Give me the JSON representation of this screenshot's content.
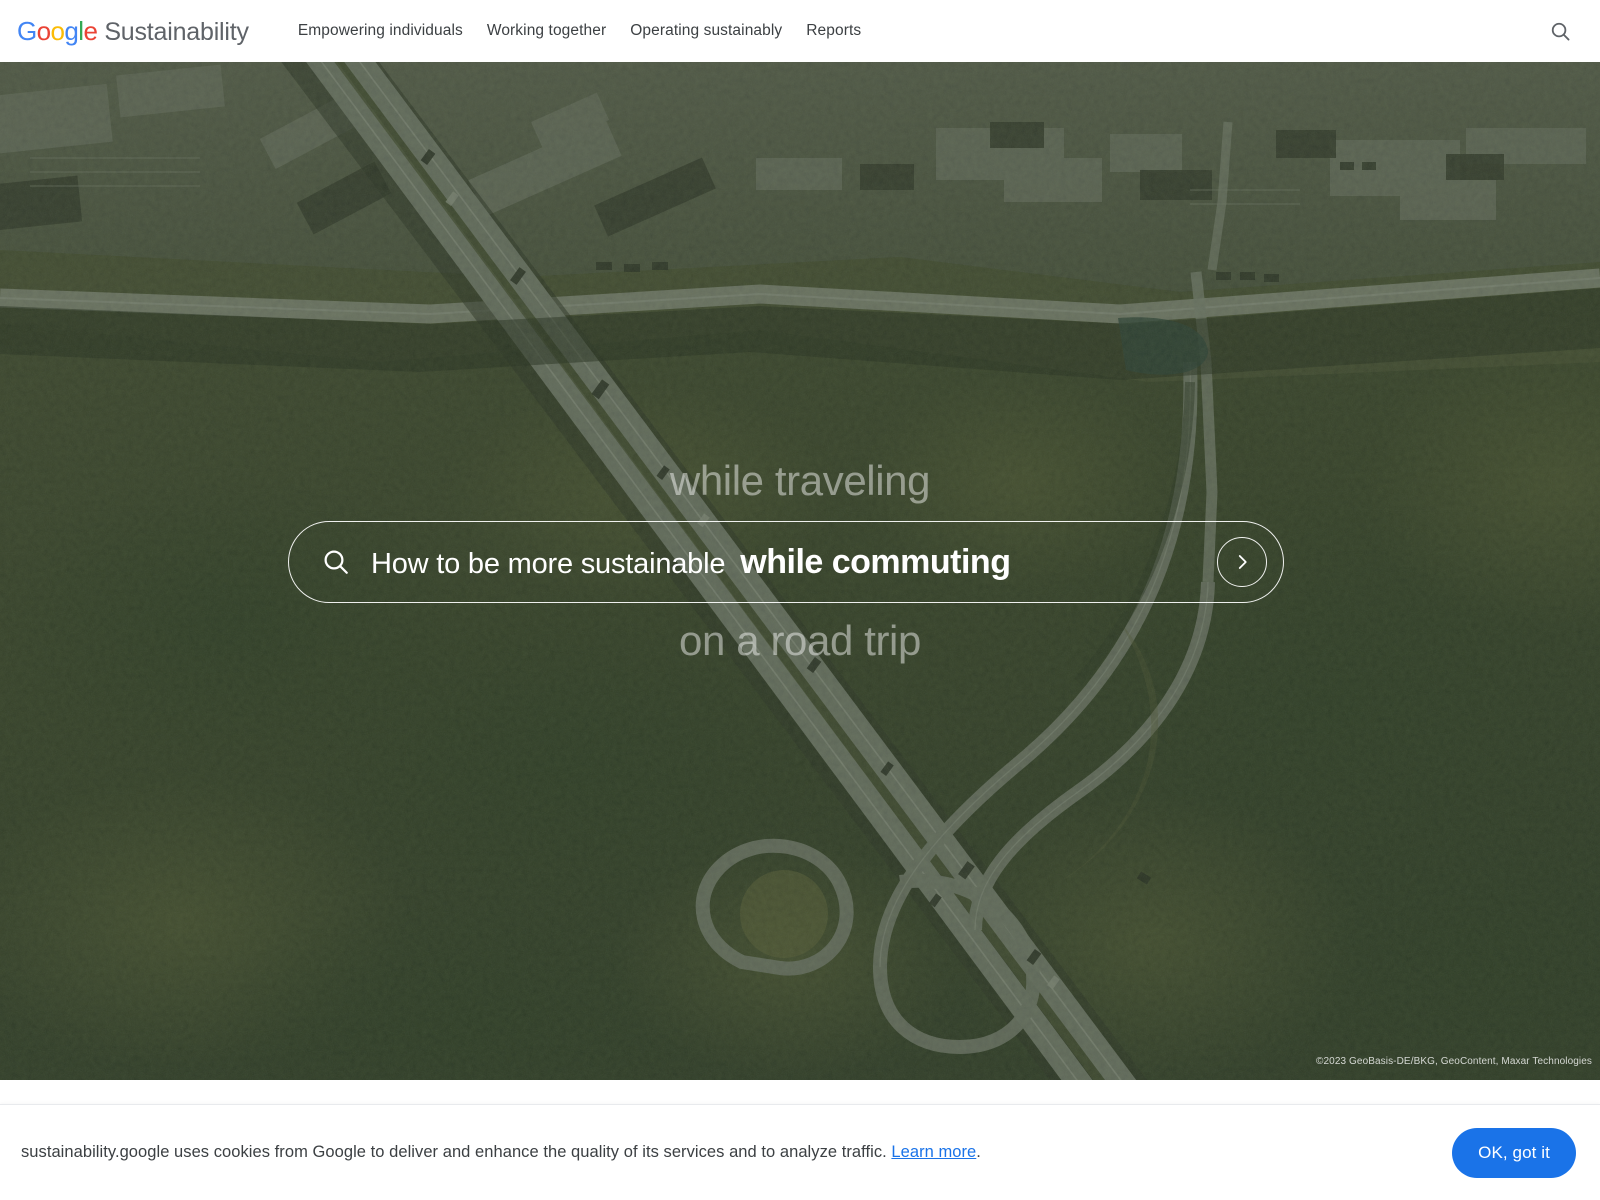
{
  "header": {
    "logo": {
      "google_letters": [
        {
          "ch": "G",
          "color": "#4285f4"
        },
        {
          "ch": "o",
          "color": "#ea4335"
        },
        {
          "ch": "o",
          "color": "#fbbc05"
        },
        {
          "ch": "g",
          "color": "#4285f4"
        },
        {
          "ch": "l",
          "color": "#34a853"
        },
        {
          "ch": "e",
          "color": "#ea4335"
        }
      ],
      "product": "Sustainability"
    },
    "nav": [
      {
        "label": "Empowering individuals"
      },
      {
        "label": "Working together"
      },
      {
        "label": "Operating sustainably"
      },
      {
        "label": "Reports"
      }
    ],
    "search_icon": "search-icon"
  },
  "hero": {
    "phrase_above": "while traveling",
    "phrase_below": "on a road trip",
    "search": {
      "icon": "search-icon",
      "prefix": "How to be more sustainable",
      "highlight": "while commuting",
      "submit_icon": "chevron-right-icon"
    },
    "attribution": "©2023 GeoBasis-DE/BKG, GeoContent, Maxar Technologies"
  },
  "cookie_banner": {
    "text_before_link": "sustainability.google uses cookies from Google to deliver and enhance the quality of its services and to analyze traffic. ",
    "link_label": "Learn more",
    "text_after_link": ".",
    "accept_label": "OK, got it",
    "accent_color": "#1a73e8"
  }
}
